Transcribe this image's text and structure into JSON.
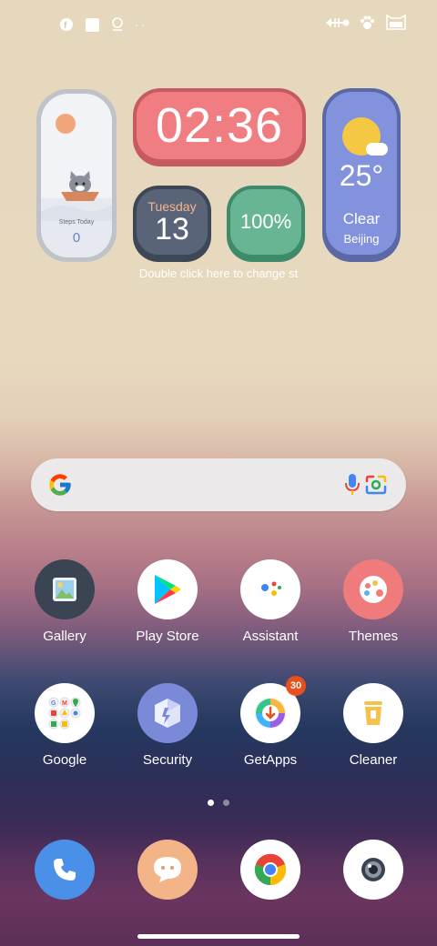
{
  "status_bar": {
    "left_icons": [
      "f-notification-icon",
      "square-notification-icon",
      "location-pin-icon",
      "more-dots-icon"
    ],
    "more_dots": "··",
    "right_icons": [
      "fish-bone-icon",
      "paw-icon",
      "cat-battery-icon"
    ]
  },
  "widgets": {
    "steps": {
      "label": "Steps Today",
      "value": "0"
    },
    "clock": {
      "time": "02:36"
    },
    "date": {
      "weekday": "Tuesday",
      "day": "13"
    },
    "battery": {
      "percent": "100%"
    },
    "weather": {
      "temperature": "25°",
      "condition": "Clear",
      "city": "Beijing"
    },
    "hint": "Double click here to change st"
  },
  "search": {
    "icons": [
      "google-g-icon",
      "mic-icon",
      "google-lens-icon"
    ]
  },
  "apps": [
    {
      "name": "Gallery",
      "icon": "gallery-icon"
    },
    {
      "name": "Play Store",
      "icon": "play-store-icon"
    },
    {
      "name": "Assistant",
      "icon": "assistant-icon"
    },
    {
      "name": "Themes",
      "icon": "themes-icon"
    },
    {
      "name": "Google",
      "icon": "google-folder-icon"
    },
    {
      "name": "Security",
      "icon": "security-icon"
    },
    {
      "name": "GetApps",
      "icon": "getapps-icon",
      "badge": "30"
    },
    {
      "name": "Cleaner",
      "icon": "cleaner-icon"
    }
  ],
  "page_indicator": {
    "pages": 2,
    "current": 1
  },
  "dock": [
    {
      "icon": "phone-icon"
    },
    {
      "icon": "messaging-icon"
    },
    {
      "icon": "chrome-icon"
    },
    {
      "icon": "camera-icon"
    }
  ],
  "colors": {
    "clock_bg": "#ef7d82",
    "date_bg": "#5a6478",
    "battery_bg": "#67b592",
    "weather_bg": "#8292dc",
    "badge": "#e8501c"
  }
}
